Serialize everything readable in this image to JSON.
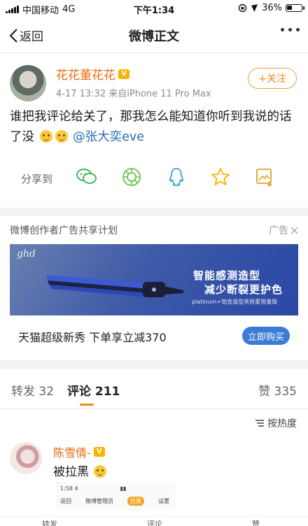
{
  "status_bar": {
    "carrier": "中国移动",
    "network": "4G",
    "time": "下午1:34",
    "battery": "36%"
  },
  "nav": {
    "back_label": "返回",
    "title": "微博正文"
  },
  "post": {
    "author": "花花董花花",
    "date": "4-17 13:32",
    "source": "来自iPhone 11 Pro Max",
    "follow_label": "+关注",
    "text": "谁把我评论给关了，那我怎么能知道你听到我说的话了没",
    "mention": "@张大奕eve",
    "share_label": "分享到",
    "share_targets": [
      "wechat",
      "moments",
      "qq",
      "qzone",
      "save-image"
    ]
  },
  "ad": {
    "program": "微博创作者广告共享计划",
    "tag": "广告",
    "brand": "ghd",
    "headline_1": "智能感测造型",
    "headline_2": "减少断裂更护色",
    "subline": "platinum+铂金造型夹吞夏限量版",
    "title": "天猫超级新秀  下单享立减370",
    "buy_label": "立即购买",
    "accent": "#3a7bd5"
  },
  "tabs": {
    "repost_label": "转发",
    "repost_count": "32",
    "comment_label": "评论",
    "comment_count": "211",
    "like_label": "赞",
    "like_count": "335",
    "sort_label": "按热度"
  },
  "comment": {
    "author": "陈雪倩-",
    "text": "被拉黑",
    "inner_time": "1:58 4",
    "inner_back": "返回",
    "inner_title": "微博管理员",
    "inner_action": "拉黑",
    "inner_settings": "设置"
  },
  "bottom_bar": {
    "repost": "转发",
    "comment": "评论",
    "like": "赞"
  }
}
